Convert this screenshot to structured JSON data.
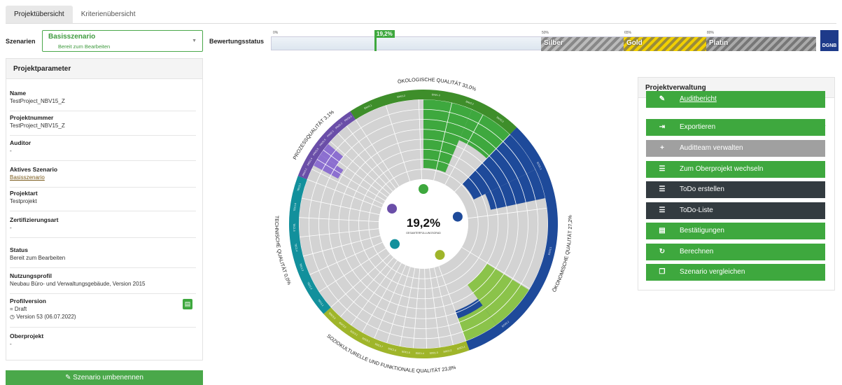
{
  "tabs": [
    "Projektübersicht",
    "Kriterienübersicht"
  ],
  "scenario": {
    "label": "Szenarien",
    "name": "Basisszenario",
    "status": "Bereit zum Bearbeiten"
  },
  "bewertung": {
    "label": "Bewertungsstatus",
    "value": "19,2%",
    "value_fraction": 0.192,
    "ticks": [
      "0%",
      "50%",
      "65%",
      "80%"
    ],
    "levels": [
      "Silber",
      "Gold",
      "Platin"
    ],
    "logo": "DGNB"
  },
  "projektparameter": {
    "title": "Projektparameter",
    "fields": [
      {
        "key": "Name",
        "value": "TestProject_NBV15_Z"
      },
      {
        "key": "Projektnummer",
        "value": "TestProject_NBV15_Z"
      },
      {
        "key": "Auditor",
        "value": "-"
      },
      {
        "key": "Aktives Szenario",
        "value": "Basisszenario"
      },
      {
        "key": "Projektart",
        "value": "Testprojekt"
      },
      {
        "key": "Zertifizierungsart",
        "value": "-"
      },
      {
        "key": "Status",
        "value": "Bereit zum Bearbeiten"
      },
      {
        "key": "Nutzungsprofil",
        "value": "Neubau Büro- und Verwaltungsgebäude, Version 2015"
      }
    ],
    "profilversion": {
      "key": "Profilversion",
      "draft": "Draft",
      "version": "Version 53 (06.07.2022)"
    },
    "oberprojekt": {
      "key": "Oberprojekt",
      "value": "-"
    },
    "rename_button": "Szenario umbenennen"
  },
  "wheel": {
    "center_value": "19,2%",
    "center_label": "GESAMTERFÜLLUNGSGRAD",
    "sections": [
      {
        "name": "ÖKOLOGISCHE QUALITÄT",
        "percent": "33,0%",
        "color": "#3e8e2a"
      },
      {
        "name": "ÖKONOMISCHE QUALITÄT",
        "percent": "27,2%",
        "color": "#1e4a9a"
      },
      {
        "name": "SOZIOKULTURELLE UND FUNKTIONALE QUALITÄT",
        "percent": "23,8%",
        "color": "#9fb52a"
      },
      {
        "name": "TECHNISCHE QUALITÄT",
        "percent": "0,0%",
        "color": "#12909c"
      },
      {
        "name": "PROZESSQUALITÄT",
        "percent": "3,1%",
        "color": "#6a4ea8"
      }
    ],
    "criteria": {
      "eco": [
        "ENV1.1",
        "ENV1.2",
        "ENV1.3",
        "ENV2.2",
        "ENV2.3"
      ],
      "econ": [
        "ECO1.1",
        "ECO2.1",
        "ECO2.2"
      ],
      "soc": [
        "SOC1.1",
        "SOC1.2",
        "SOC1.3",
        "SOC1.4",
        "SOC1.5",
        "SOC1.6",
        "SOC1.7",
        "SOC2.1",
        "SOC3.1",
        "SOC3.2",
        "SOC3.3"
      ],
      "tec": [
        "TEC1.1",
        "TEC1.2",
        "TEC1.3",
        "TEC1.4",
        "TEC1.5",
        "TEC1.6",
        "TEC3.1"
      ],
      "pro": [
        "PRO1.1",
        "PRO1.4",
        "PRO1.5",
        "PRO1.6",
        "PRO2.1",
        "PRO2.2",
        "PRO2.3"
      ]
    }
  },
  "projektverwaltung": {
    "title": "Projektverwaltung",
    "buttons": [
      {
        "label": "Auditbericht",
        "icon": "report-icon"
      },
      {
        "label": "Exportieren",
        "icon": "export-icon"
      },
      {
        "label": "Auditteam verwalten",
        "icon": "user-plus-icon"
      },
      {
        "label": "Zum Oberprojekt wechseln",
        "icon": "list-icon"
      },
      {
        "label": "ToDo erstellen",
        "icon": "list-icon"
      },
      {
        "label": "ToDo-Liste",
        "icon": "list-icon"
      },
      {
        "label": "Bestätigungen",
        "icon": "document-icon"
      },
      {
        "label": "Berechnen",
        "icon": "refresh-icon"
      },
      {
        "label": "Szenario vergleichen",
        "icon": "copy-icon"
      }
    ]
  }
}
